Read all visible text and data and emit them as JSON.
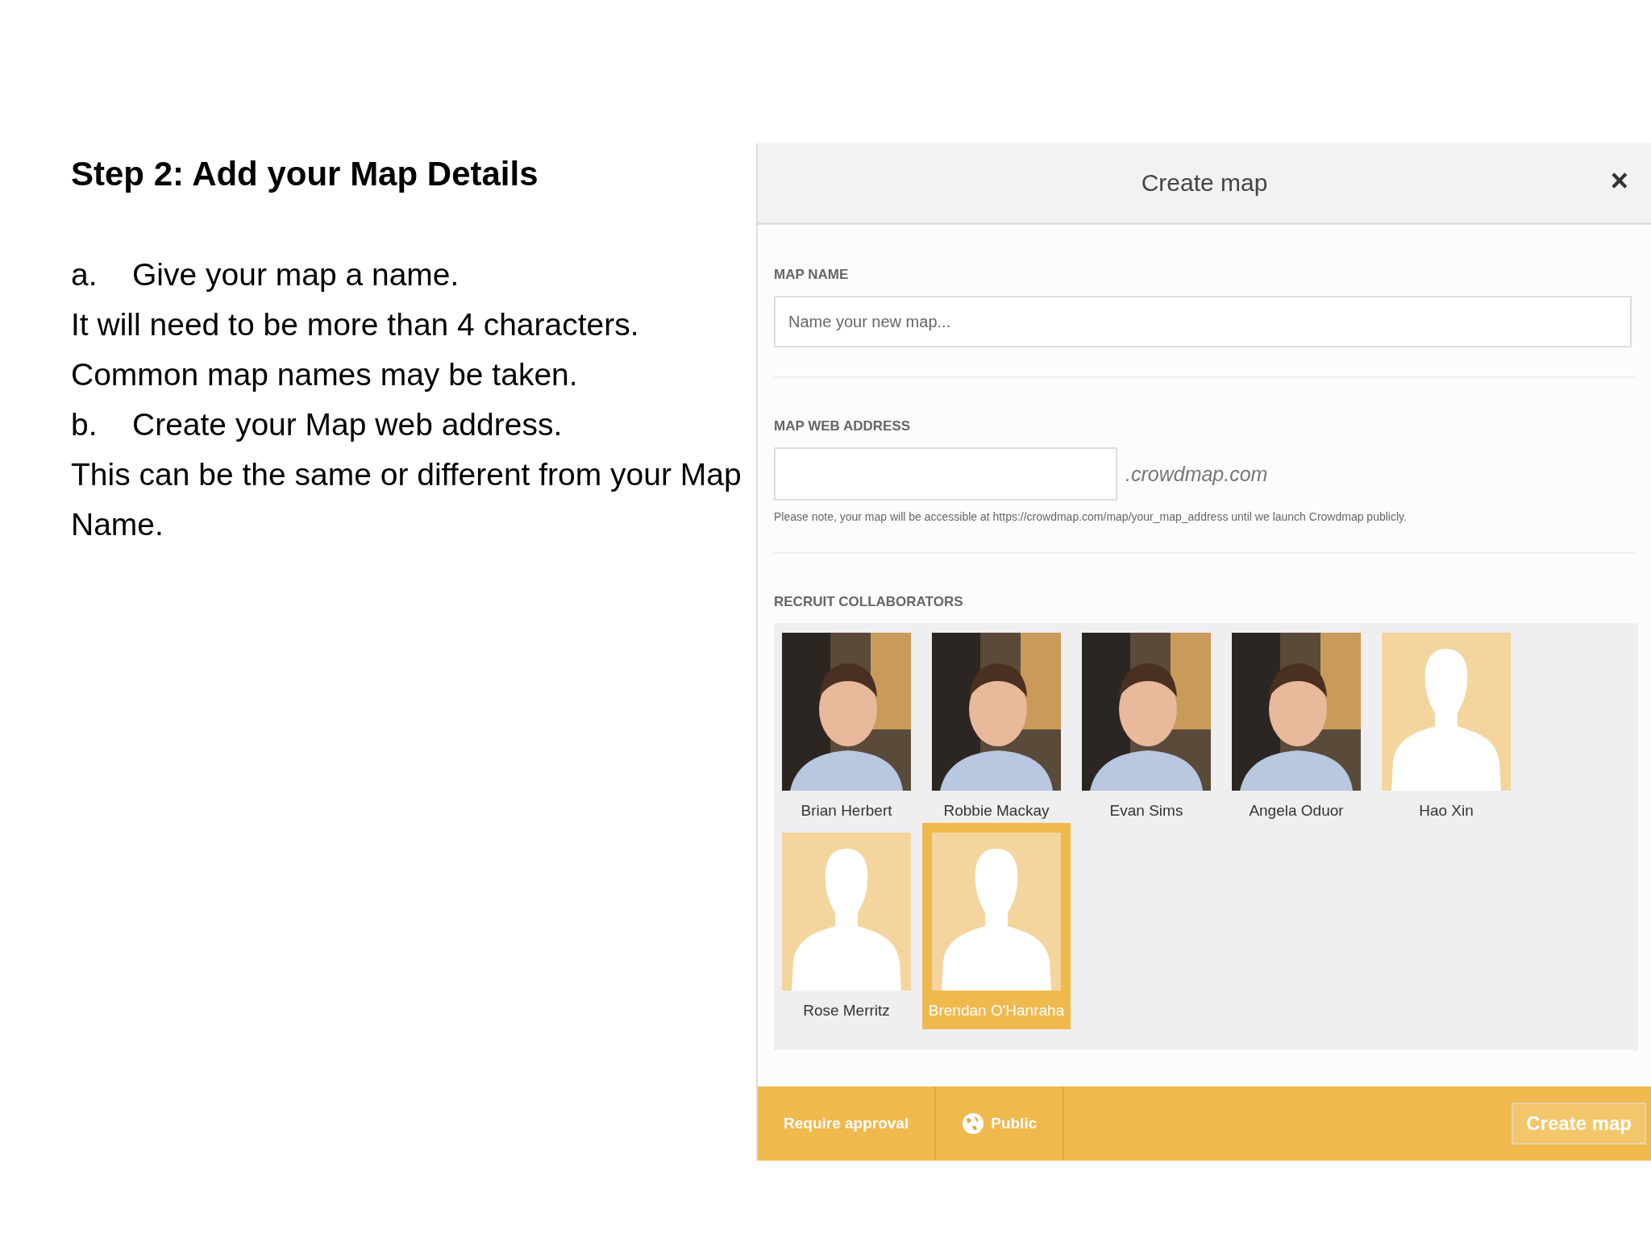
{
  "slide": {
    "heading": "Step 2: Add your Map Details",
    "paragraphs": [
      {
        "marker": "a.",
        "text": "Give your map a name."
      },
      {
        "text": "It will need to be more than 4 characters. Common map names may be taken."
      },
      {
        "marker": "b.",
        "text": "Create your Map web address."
      },
      {
        "text": "This can be the same or different from your Map Name."
      }
    ]
  },
  "dialog": {
    "title": "Create map",
    "close": "×",
    "map_name": {
      "label": "MAP NAME",
      "placeholder": "Name your new map..."
    },
    "web_address": {
      "label": "MAP WEB ADDRESS",
      "suffix": ".crowdmap.com",
      "note": "Please note, your map will be accessible at https://crowdmap.com/map/your_map_address until we launch Crowdmap publicly."
    },
    "collaborators": {
      "label": "RECRUIT COLLABORATORS",
      "people": [
        {
          "name": "Brian Herbert",
          "selected": false
        },
        {
          "name": "Robbie Mackay",
          "selected": false
        },
        {
          "name": "Evan Sims",
          "selected": false
        },
        {
          "name": "Angela Oduor",
          "selected": false
        },
        {
          "name": "Hao Xin",
          "kind": "placeholder",
          "selected": false
        },
        {
          "name": "Rose Merritz",
          "kind": "placeholder",
          "selected": false
        },
        {
          "name": "Brendan O'Hanraha",
          "kind": "placeholder",
          "selected": true
        }
      ]
    },
    "footer": {
      "require_approval": "Require approval",
      "visibility": "Public",
      "submit": "Create map"
    }
  }
}
